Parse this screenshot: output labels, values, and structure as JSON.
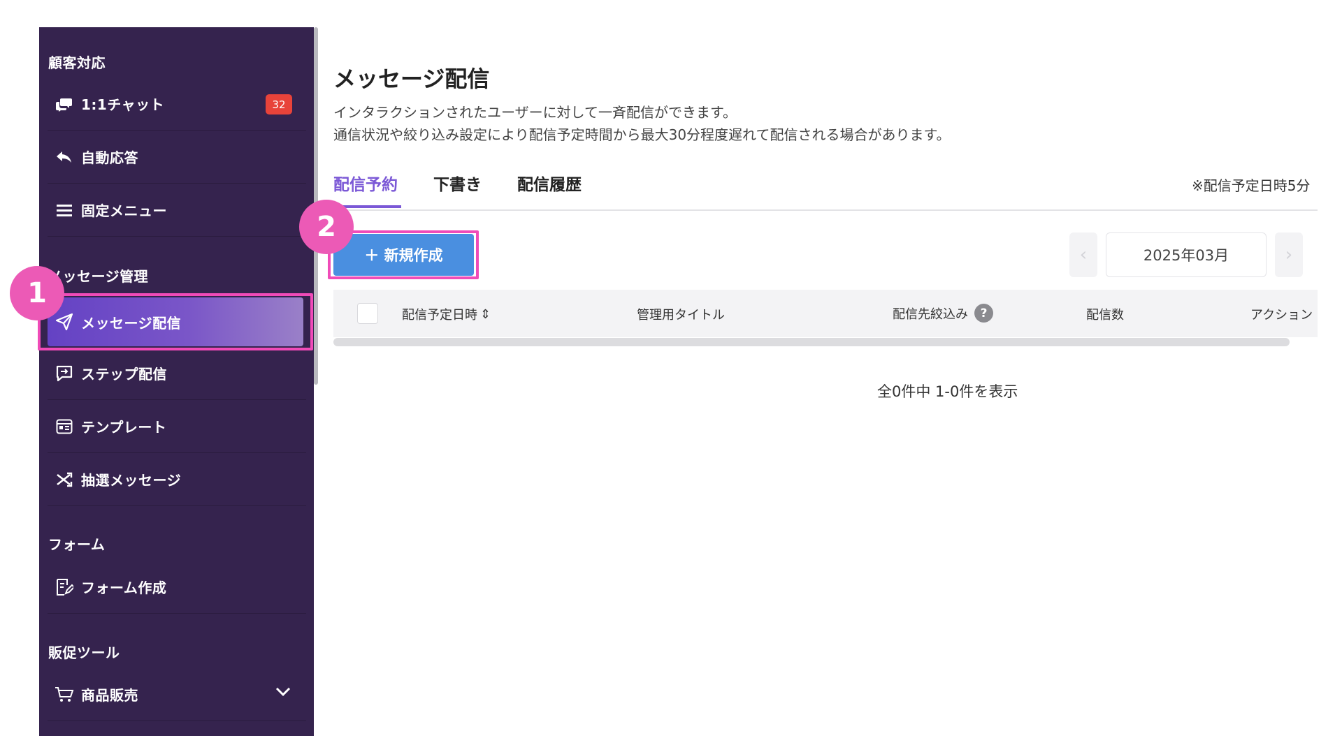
{
  "sidebar": {
    "sections": {
      "customer": "顧客対応",
      "message": "メッセージ管理",
      "form": "フォーム",
      "promo": "販促ツール"
    },
    "items": {
      "chat": {
        "label": "1:1チャット",
        "badge": "32",
        "icon": "chat-bubbles-icon"
      },
      "auto_reply": {
        "label": "自動応答",
        "icon": "reply-icon"
      },
      "fixed_menu": {
        "label": "固定メニュー",
        "icon": "menu-icon"
      },
      "broadcast": {
        "label": "メッセージ配信",
        "icon": "paper-plane-icon",
        "active": true
      },
      "step": {
        "label": "ステップ配信",
        "icon": "step-message-icon"
      },
      "template": {
        "label": "テンプレート",
        "icon": "template-icon"
      },
      "lottery": {
        "label": "抽選メッセージ",
        "icon": "shuffle-icon"
      },
      "form_create": {
        "label": "フォーム作成",
        "icon": "form-edit-icon"
      },
      "product_sales": {
        "label": "商品販売",
        "icon": "cart-icon"
      }
    }
  },
  "callouts": {
    "one": "1",
    "two": "2"
  },
  "main": {
    "title": "メッセージ配信",
    "description_1": "インタラクションされたユーザーに対して一斉配信ができます。",
    "description_2": "通信状況や絞り込み設定により配信予定時間から最大30分程度遅れて配信される場合があります。",
    "tabs": [
      "配信予約",
      "下書き",
      "配信履歴"
    ],
    "note": "※配信予定日時5分",
    "new_button": "＋ 新規作成",
    "pager": {
      "prev": "‹",
      "month": "2025年03月",
      "next": "›"
    },
    "table": {
      "columns": [
        "配信予定日時",
        "管理用タイトル",
        "配信先絞込み",
        "配信数",
        "アクション"
      ],
      "sort_icon": "⇕",
      "help": "?"
    },
    "summary": "全0件中 1-0件を表示"
  },
  "colors": {
    "sidebar_bg": "#35234e",
    "accent": "#7b58d6",
    "button": "#4a8fe0",
    "highlight": "#f04bb8",
    "badge": "#e8433a"
  }
}
